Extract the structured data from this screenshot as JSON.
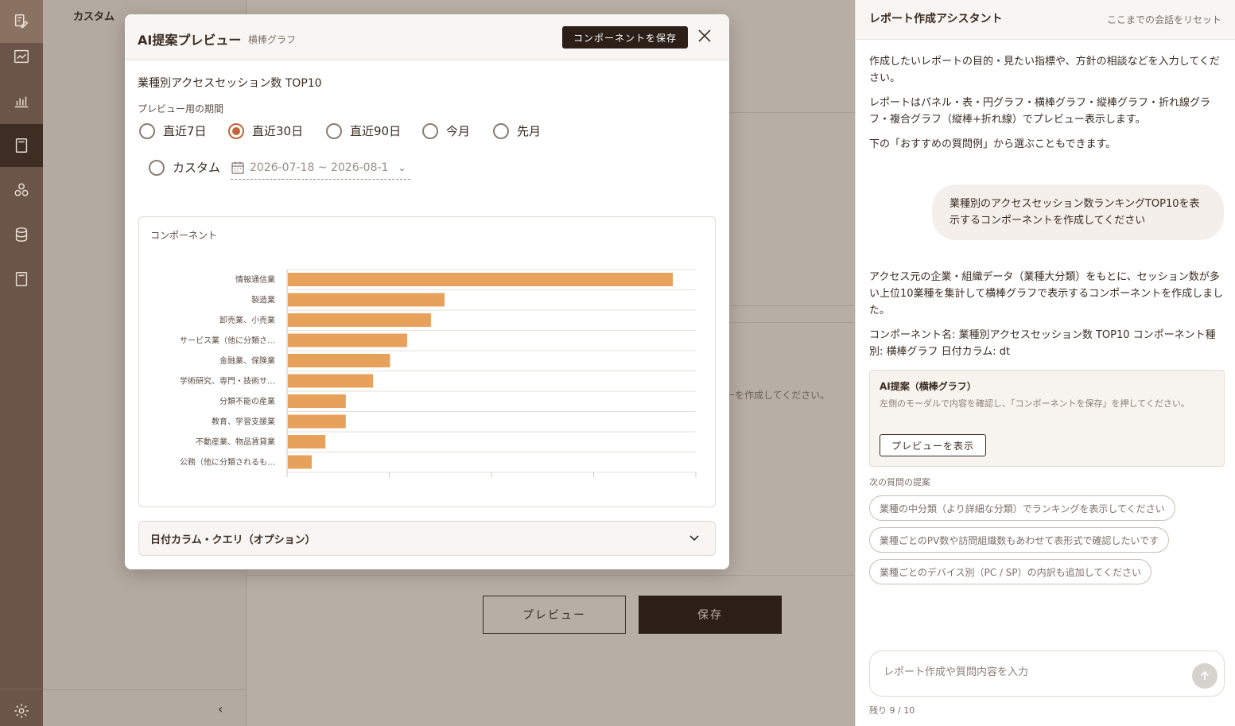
{
  "sidebar": {
    "title": "カスタム",
    "icons": [
      "report-edit-icon",
      "line-chart-icon",
      "bar-chart-icon",
      "document-icon",
      "network-icon",
      "database-icon",
      "page-icon"
    ],
    "settings_icon": "gear-icon",
    "collapse_icon": "chevron-left-icon"
  },
  "background": {
    "hint_text": "ーを作成してください。",
    "preview_button": "プレビュー",
    "save_button": "保存"
  },
  "modal": {
    "title": "AI提案プレビュー",
    "subtitle": "横棒グラフ",
    "save_component_button": "コンポーネントを保存",
    "component_name": "業種別アクセスセッション数 TOP10",
    "period_label": "プレビュー用の期間",
    "period_options": [
      "直近7日",
      "直近30日",
      "直近90日",
      "今月",
      "先月"
    ],
    "selected_period": "直近30日",
    "custom_label": "カスタム",
    "date_range": "2026-07-18 ~ 2026-08-1",
    "component_box_label": "コンポーネント",
    "accordion_label": "日付カラム・クエリ（オプション）"
  },
  "chart_data": {
    "type": "bar",
    "orientation": "horizontal",
    "categories": [
      "情報通信業",
      "製造業",
      "卸売業、小売業",
      "サービス業（他に分類さ…",
      "金融業、保険業",
      "学術研究、専門・技術サ…",
      "分類不能の産業",
      "教育、学習支援業",
      "不動産業、物品賃貸業",
      "公務（他に分類されるも…"
    ],
    "values": [
      113,
      46,
      42,
      35,
      30,
      25,
      17,
      17,
      11,
      7
    ],
    "xlim": [
      0,
      120
    ],
    "grid": true,
    "bar_color": "#e8a15a"
  },
  "assistant": {
    "title": "レポート作成アシスタント",
    "reset_link": "ここまでの会話をリセット",
    "intro1": "作成したいレポートの目的・見たい指標や、方針の相談などを入力してください。",
    "intro2": "レポートはパネル・表・円グラフ・横棒グラフ・縦棒グラフ・折れ線グラフ・複合グラフ（縦棒+折れ線）でプレビュー表示します。",
    "intro3": "下の「おすすめの質問例」から選ぶこともできます。",
    "user_message": "業種別のアクセスセッション数ランキングTOP10を表示するコンポーネントを作成してください",
    "ai_message1": "アクセス元の企業・組織データ（業種大分類）をもとに、セッション数が多い上位10業種を集計して横棒グラフで表示するコンポーネントを作成しました。",
    "ai_message2": "コンポーネント名: 業種別アクセスセッション数 TOP10 コンポーネント種別: 横棒グラフ 日付カラム: dt",
    "ai_card_title": "AI提案（横棒グラフ）",
    "ai_card_desc": "左側のモーダルで内容を確認し、「コンポーネントを保存」を押してください。",
    "ai_card_button": "プレビューを表示",
    "next_label": "次の質問の提案",
    "suggestions": [
      "業種の中分類（より詳細な分類）でランキングを表示してください",
      "業種ごとのPV数や訪問組織数もあわせて表形式で確認したいです",
      "業種ごとのデバイス別（PC / SP）の内訳も追加してください"
    ],
    "input_placeholder": "レポート作成や質問内容を入力",
    "remaining": "残り 9 / 10"
  }
}
